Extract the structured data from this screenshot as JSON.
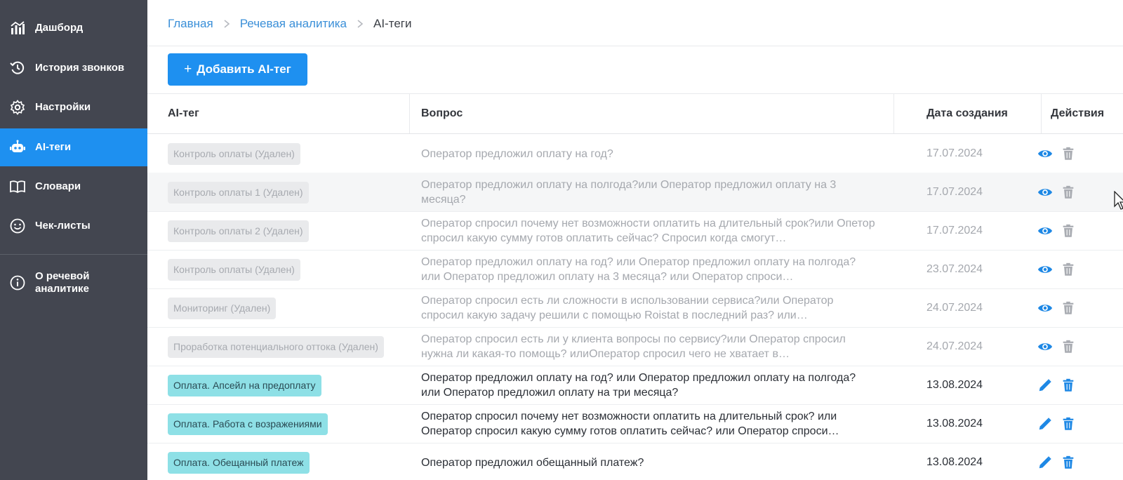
{
  "sidebar": {
    "items": [
      {
        "label": "Дашборд",
        "icon": "chart-icon"
      },
      {
        "label": "История звонков",
        "icon": "history-icon"
      },
      {
        "label": "Настройки",
        "icon": "gear-icon"
      },
      {
        "label": "AI-теги",
        "icon": "robot-icon",
        "active": true
      },
      {
        "label": "Словари",
        "icon": "book-icon"
      },
      {
        "label": "Чек-листы",
        "icon": "smile-icon"
      }
    ],
    "info": {
      "label_line1": "О речевой",
      "label_line2": "аналитике",
      "icon": "info-icon"
    }
  },
  "breadcrumb": {
    "home": "Главная",
    "section": "Речевая аналитика",
    "current": "AI-теги"
  },
  "toolbar": {
    "add_plus": "+",
    "add_label": "Добавить AI-тег"
  },
  "table": {
    "headers": {
      "tag": "AI-тег",
      "question": "Вопрос",
      "date": "Дата создания",
      "actions": "Действия"
    },
    "rows": [
      {
        "tag": "Контроль оплаты (Удален)",
        "question": "Оператор предложил оплату на год?",
        "date": "17.07.2024",
        "status": "deleted"
      },
      {
        "tag": "Контроль оплаты 1 (Удален)",
        "question": "Оператор предложил оплату на полгода?или Оператор предложил оплату на 3 месяца?",
        "date": "17.07.2024",
        "status": "deleted"
      },
      {
        "tag": "Контроль оплаты 2 (Удален)",
        "question": "Оператор спросил почему нет возможности оплатить на длительный срок?или Опетор спросил какую сумму готов оплатить сейчас? Спросил когда смогут…",
        "date": "17.07.2024",
        "status": "deleted"
      },
      {
        "tag": "Контроль оплаты (Удален)",
        "question": "Оператор предложил оплату на год? или Оператор предложил оплату на полгода? или Оператор предложил оплату на 3 месяца? или Оператор спроси…",
        "date": "23.07.2024",
        "status": "deleted"
      },
      {
        "tag": "Мониторинг (Удален)",
        "question": "Оператор спросил есть ли сложности в использовании сервиса?или Оператор спросил какую задачу решили с помощью Roistat в последний раз? или…",
        "date": "24.07.2024",
        "status": "deleted"
      },
      {
        "tag": "Проработка потенциального оттока (Удален)",
        "question": "Оператор спросил есть ли у клиента вопросы по сервису?или Оператор спросил нужна ли какая-то помощь? илиОператор спросил чего не хватает в…",
        "date": "24.07.2024",
        "status": "deleted"
      },
      {
        "tag": "Оплата. Апсейл на предоплату",
        "question": "Оператор предложил оплату на год? или Оператор предложил оплату на полгода? или Оператор предложил оплату на три месяца?",
        "date": "13.08.2024",
        "status": "active"
      },
      {
        "tag": "Оплата. Работа с возражениями",
        "question": "Оператор спросил почему нет возможности оплатить на длительный срок? или Оператор спросил какую сумму готов оплатить сейчас? или Оператор спроси…",
        "date": "13.08.2024",
        "status": "active"
      },
      {
        "tag": "Оплата. Обещанный платеж",
        "question": "Оператор предложил обещанный платеж?",
        "date": "13.08.2024",
        "status": "active"
      }
    ]
  },
  "colors": {
    "sidebar_bg": "#434650",
    "accent": "#1e90f0",
    "active_tag": "#8ee0e6",
    "deleted_tag": "#e9eaec",
    "action_blue": "#1e88e5",
    "deleted_trash": "#a9acb2"
  }
}
